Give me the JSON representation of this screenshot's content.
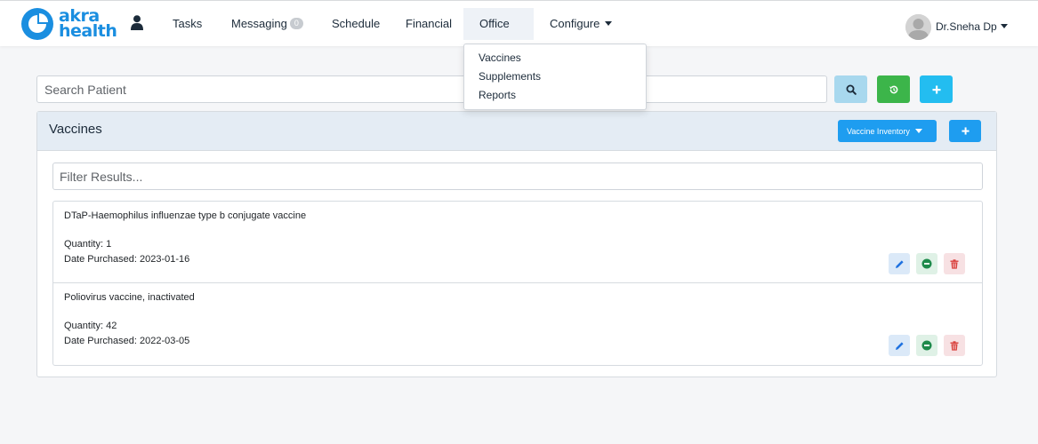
{
  "brand": {
    "line1": "akra",
    "line2": "health",
    "color": "#1a8ee0"
  },
  "nav": {
    "tasks": "Tasks",
    "messaging": "Messaging",
    "messaging_count": "0",
    "schedule": "Schedule",
    "financial": "Financial",
    "office": "Office",
    "configure": "Configure"
  },
  "user": {
    "name": "Dr.Sneha Dp"
  },
  "office_menu": {
    "items": [
      "Vaccines",
      "Supplements",
      "Reports"
    ]
  },
  "search": {
    "placeholder": "Search Patient"
  },
  "card": {
    "title": "Vaccines",
    "inventory_button": "Vaccine Inventory",
    "filter_placeholder": "Filter Results..."
  },
  "vaccines": [
    {
      "name": "DTaP-Haemophilus influenzae type b conjugate vaccine",
      "quantity": "Quantity: 1",
      "date": "Date Purchased: 2023-01-16"
    },
    {
      "name": "Poliovirus vaccine, inactivated",
      "quantity": "Quantity: 42",
      "date": "Date Purchased: 2022-03-05"
    }
  ],
  "colors": {
    "primary": "#1e9df0",
    "search_btn": "#a8d8ee",
    "reset_btn": "#3cb54a",
    "add_btn": "#23bdf0",
    "edit": "#1f72e0",
    "minus": "#1e8a4b",
    "delete": "#d9403c"
  }
}
